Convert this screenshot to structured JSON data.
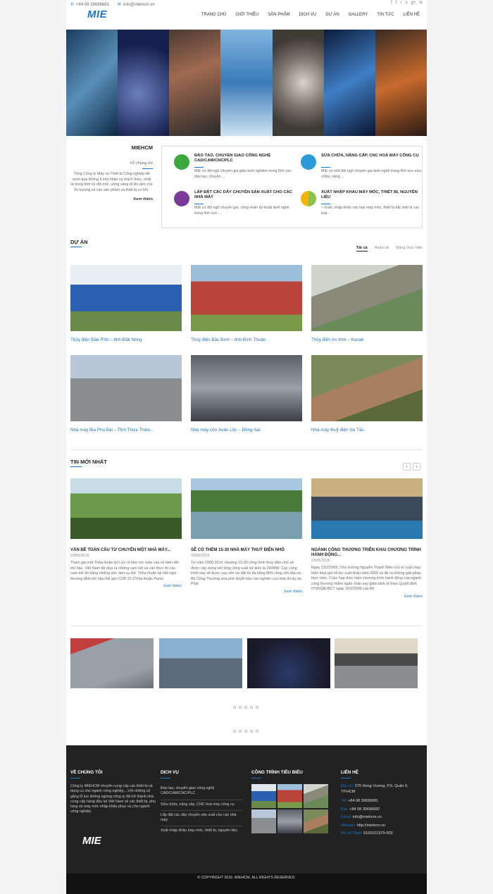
{
  "topbar": {
    "phone": "+84 08 39696681",
    "email": "info@miehcm.vn"
  },
  "social_icons": [
    "facebook-icon",
    "twitter-icon",
    "rss-icon",
    "skype-icon",
    "google-plus-icon",
    "linkedin-icon"
  ],
  "social_glyphs": [
    "f",
    "t",
    "r",
    "s",
    "g+",
    "in"
  ],
  "logo": "MIE",
  "nav": [
    "TRANG CHỦ",
    "GIỚI THIỆU",
    "SẢN PHẨM",
    "DỊCH VỤ",
    "DỰ ÁN",
    "GALLERY",
    "TIN TỨC",
    "LIÊN HỆ"
  ],
  "about": {
    "title": "MIEHCM",
    "subtitle": "Về chúng tôi",
    "text": "Tổng Công ty Máy và Thiết bị Công nghiệp đã vượt qua không ít khó khăn và thách thức, nhất là trong thời kỳ đổi mới, vững vàng đi lên làm chủ thị trường về các sản phẩm và thiết bị cơ khí.",
    "more": "Xem thêm"
  },
  "services": [
    {
      "title": "ĐÀO TẠO, CHUYỂN GIAO CÔNG NGHỆ CAD/CAM/CNC/PLC",
      "desc": "MIE có đội ngũ chuyên gia giàu kinh nghiệm trong lĩnh vực đào tạo, chuyển ..."
    },
    {
      "title": "SỬA CHỮA, NÂNG CẤP, CNC HOÁ MÁY CÔNG CỤ",
      "desc": "MIE có một đội ngũ chuyên gia lành nghề trong lĩnh vực sửa chữa, nâng ..."
    },
    {
      "title": "LẮP ĐẶT CÁC DÂY CHUYỀN SẢN XUẤT CHO CÁC NHÀ MÁY",
      "desc": "MIE có đội ngũ chuyên gia, công nhân kỹ thuật lành nghề trong lĩnh vực ..."
    },
    {
      "title": "XUẤT NHẬP KHẨU MÁY MÓC, THIẾT BỊ, NGUYÊN LIỆU",
      "desc": "– Xuất, nhập khẩu các loại máy móc, thiết bị đặc biệt là các loại..."
    }
  ],
  "projects": {
    "title": "DỰ ÁN",
    "filters": [
      "Tất cả",
      "Hoàn tất",
      "Đang thực hiện"
    ],
    "items": [
      "Thủy điện Đắk R'tih – tỉnh Đắk Nông",
      "Thủy điện Bắc Bình – tỉnh Bình Thuận",
      "Thủy điện An Khê – Kanak",
      "Nhà máy Bia Phú Bài – Tỉnh Thừa Thiên...",
      "Nhà máy cồn Xuân Lộc – Đồng Nai",
      "Nhà máy thuỷ điện Nà Tấu"
    ]
  },
  "news": {
    "title": "TIN MỚI NHẤT",
    "items": [
      {
        "title": "VẤN ĐỀ TOÀN CẦU TỪ CHUYỆN MỘT NHÀ MÁY...",
        "date": "23/05/2016",
        "excerpt": "Tham gia một Thỏa thuận lịch sử có tầm vóc toàn cầu về biến đổi khí hậu, Việt Nam đã đưa ra những cam kết và cần thực thi các cam kết đó bằng những việc làm cụ thể. Thỏa thuận tại Hội nghị thượng đỉnh khí hậu thế giới COP 21 (Thỏa thuận Paris).",
        "more": "Xem thêm"
      },
      {
        "title": "SẼ CÓ THÊM 15-30 NHÀ MÁY THUỶ ĐIỆN NHỎ",
        "date": "23/05/2016",
        "excerpt": "Từ năm 2009-2014, khoảng 15-30 công trình thuỷ điện nhỏ sẽ được xây dựng với tổng công suất dự kiến là 250MW. Các công trình này sẽ được vay vốn ưu đãi tối đa bằng 80% tổng vốn đầu tư. Bộ Công Thương vừa phê duyệt báo cáo nghiên cứu khả thi dự án Phát",
        "more": "Xem thêm"
      },
      {
        "title": "NGÀNH CÔNG THƯƠNG TRIỂN KHAI CHƯƠNG TRÌNH HÀNH ĐỘNG...",
        "date": "23/05/2016",
        "excerpt": "Ngày 23/2/2009, Thứ trưởng Nguyễn Thành Biên chủ trì cuộc họp triển khai gói hỗ trợ xuất khẩu năm 2009 và đề ra những giải pháp thực hiện. Cuộc họp thực hiện chương trình hành động của ngành công thương nhằm ngăn chặn suy giảm kinh tế theo Quyết định 0795/QĐ-BCT ngày 16/2/2009 của Bộ",
        "more": "Xem thêm"
      }
    ]
  },
  "footer": {
    "about": {
      "title": "VỀ CHÚNG TÔI",
      "text": "Công ty MIEHCM chuyên cung cấp các thiết bị và dụng cụ cho ngành công nghiệp,...Với những cố gắng lỗ lực không ngừng công ty đã trở thành nhà cung cấp hàng đầu tại Việt Nam về các thiết bị, phụ tùng và máy móc nhập khẩu phục vụ cho ngành công nghiệp.",
      "logo": "MIE"
    },
    "services": {
      "title": "DỊCH VỤ",
      "items": [
        "Đào tạo, chuyển giao công nghệ CAD/CAM/CNC/PLC",
        "Sửa chữa, nâng cấp, CNC hoá máy công cụ",
        "Lắp đặt các dây chuyền sản xuất cho các nhà máy",
        "Xuất nhập khẩu máy móc, thiết bị, nguyên liệu"
      ]
    },
    "works": {
      "title": "CÔNG TRÌNH TIÊU BIỂU"
    },
    "contact": {
      "title": "LIÊN HỆ",
      "address_label": "Địa chỉ:",
      "address": "275 Hùng Vương, P.9, Quận 6, TP.HCM",
      "tel_label": "Tel:",
      "tel": "+84 08 39696681",
      "fax_label": "Fax:",
      "fax": "+84 08 39696682",
      "email_label": "Email:",
      "email": "info@miehcm.vn",
      "website_label": "Website:",
      "website": "http://miehcm.vn",
      "tax_label": "Mã số Thuế:",
      "tax": "0100101379-003"
    },
    "copyright": "© COPYRIGHT 2016. MIEHCM. ALL RIGHTS RESERVED."
  },
  "colors": {
    "accent": "#1e73be",
    "footer_bg": "#222222"
  }
}
